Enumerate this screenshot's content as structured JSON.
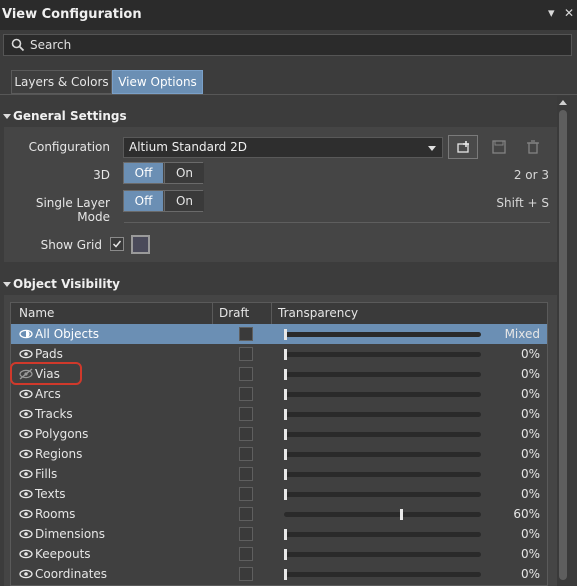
{
  "window": {
    "title": "View Configuration",
    "pin_glyph": "▾",
    "close_glyph": "✕"
  },
  "search": {
    "label": "Search"
  },
  "tabs": [
    {
      "label": "Layers & Colors",
      "active": false
    },
    {
      "label": "View Options",
      "active": true
    }
  ],
  "general": {
    "header": "General Settings",
    "configuration": {
      "label": "Configuration",
      "value": "Altium Standard 2D"
    },
    "toolbar_icons": [
      "add-config-icon",
      "save-icon",
      "delete-icon"
    ],
    "three_d": {
      "label": "3D",
      "off_label": "Off",
      "on_label": "On",
      "selected": "Off",
      "shortcut": "2 or 3"
    },
    "single_layer": {
      "label": "Single Layer Mode",
      "off_label": "Off",
      "on_label": "On",
      "selected": "Off",
      "shortcut": "Shift + S"
    },
    "show_grid": {
      "label": "Show Grid",
      "checked": true,
      "color": "#4a4a5a"
    }
  },
  "visibility": {
    "header": "Object Visibility",
    "columns": {
      "name": "Name",
      "draft": "Draft",
      "transparency": "Transparency"
    },
    "rows": [
      {
        "name": "All Objects",
        "transparency": 0,
        "display": "Mixed",
        "visible": "mixed",
        "selected": true
      },
      {
        "name": "Pads",
        "transparency": 0,
        "display": "0%",
        "visible": "on"
      },
      {
        "name": "Vias",
        "transparency": 0,
        "display": "0%",
        "visible": "off",
        "highlighted": true
      },
      {
        "name": "Arcs",
        "transparency": 0,
        "display": "0%",
        "visible": "on"
      },
      {
        "name": "Tracks",
        "transparency": 0,
        "display": "0%",
        "visible": "on"
      },
      {
        "name": "Polygons",
        "transparency": 0,
        "display": "0%",
        "visible": "on"
      },
      {
        "name": "Regions",
        "transparency": 0,
        "display": "0%",
        "visible": "on"
      },
      {
        "name": "Fills",
        "transparency": 0,
        "display": "0%",
        "visible": "on"
      },
      {
        "name": "Texts",
        "transparency": 0,
        "display": "0%",
        "visible": "on"
      },
      {
        "name": "Rooms",
        "transparency": 60,
        "display": "60%",
        "visible": "on"
      },
      {
        "name": "Dimensions",
        "transparency": 0,
        "display": "0%",
        "visible": "on"
      },
      {
        "name": "Keepouts",
        "transparency": 0,
        "display": "0%",
        "visible": "on"
      },
      {
        "name": "Coordinates",
        "transparency": 0,
        "display": "0%",
        "visible": "on"
      }
    ]
  },
  "colors": {
    "accent": "#6b8fb4",
    "highlight": "#d0392b"
  }
}
